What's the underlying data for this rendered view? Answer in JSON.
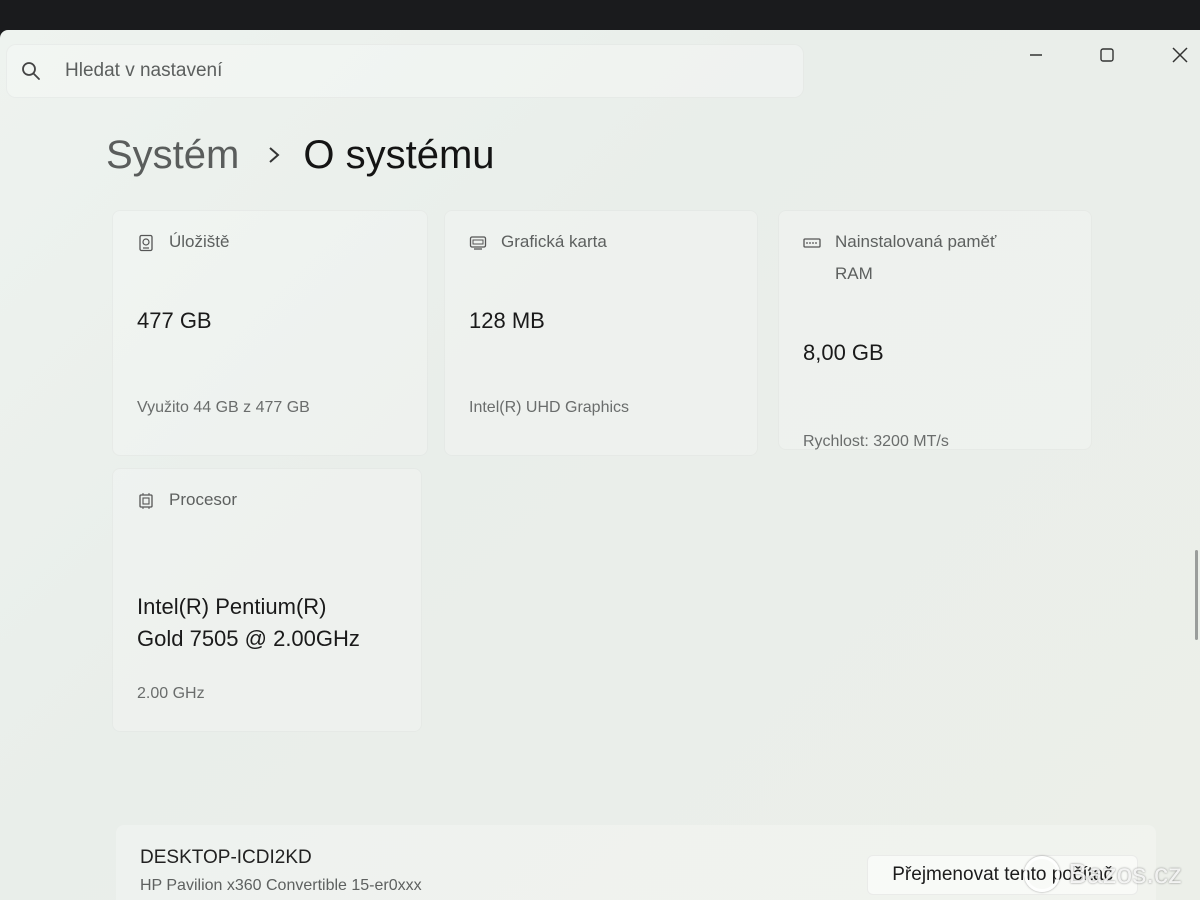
{
  "search": {
    "placeholder": "Hledat v nastavení",
    "icon": "search-icon"
  },
  "breadcrumb": {
    "parent": "Systém",
    "current": "O systému"
  },
  "specs": {
    "storage": {
      "label": "Úložiště",
      "value": "477 GB",
      "detail": "Využito 44 GB z 477 GB",
      "icon": "storage-icon"
    },
    "graphics": {
      "label": "Grafická karta",
      "value": "128 MB",
      "detail": "Intel(R) UHD Graphics",
      "icon": "graphics-card-icon"
    },
    "memory": {
      "label_line1": "Nainstalovaná paměť",
      "label_line2": "RAM",
      "value": "8,00 GB",
      "detail": "Rychlost: 3200 MT/s",
      "icon": "memory-icon"
    },
    "processor": {
      "label": "Procesor",
      "value_line1": "Intel(R) Pentium(R)",
      "value_line2": "Gold 7505 @ 2.00GHz",
      "detail": "2.00 GHz",
      "icon": "processor-icon"
    }
  },
  "device": {
    "name": "DESKTOP-ICDI2KD",
    "model": "HP Pavilion x360 Convertible 15-er0xxx",
    "rename_label": "Přejmenovat tento počítač"
  },
  "watermark": {
    "text": "Bazos.cz"
  },
  "colors": {
    "window_bg": "#ecf1ed",
    "text_primary": "#1b1b1b",
    "text_secondary": "#5d605f"
  }
}
